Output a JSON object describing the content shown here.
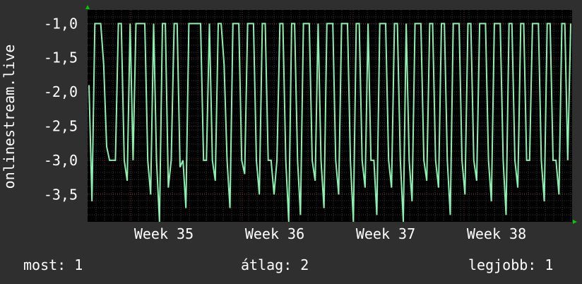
{
  "chart_data": {
    "type": "line",
    "ylabel": "onlinestream.live",
    "yticks": [
      -1.0,
      -1.5,
      -2.0,
      -2.5,
      -3.0,
      -3.5
    ],
    "ytick_labels": [
      "-1,0",
      "-1,5",
      "-2,0",
      "-2,5",
      "-3,0",
      "-3,5"
    ],
    "ylim": [
      -3.9,
      -0.8
    ],
    "xticks": [
      "Week 35",
      "Week 36",
      "Week 37",
      "Week 38"
    ],
    "grid": true,
    "colors": {
      "background": "#2f2f2f",
      "plot_area": "#000000",
      "grid": "#3a3a3a",
      "grid_major": "#6b2f2f",
      "line": "#8ef0b0",
      "arrow": "#00cc00"
    },
    "series": [
      {
        "values": [
          -1.9,
          -3.6,
          -1.0,
          -1.0,
          -1.0,
          -1.6,
          -2.8,
          -3.0,
          -3.0,
          -3.0,
          -1.0,
          -1.0,
          -3.0,
          -3.3,
          -1.0,
          -3.0,
          -1.0,
          -1.0,
          -1.0,
          -1.0,
          -3.0,
          -3.5,
          -1.0,
          -3.0,
          -3.9,
          -1.0,
          -1.0,
          -3.4,
          -3.0,
          -1.0,
          -1.0,
          -3.1,
          -3.0,
          -3.7,
          -1.0,
          -1.0,
          -1.0,
          -1.0,
          -1.0,
          -3.0,
          -3.0,
          -1.0,
          -3.0,
          -3.3,
          -1.0,
          -1.0,
          -1.6,
          -3.0,
          -3.7,
          -1.0,
          -1.0,
          -1.0,
          -3.0,
          -3.2,
          -1.0,
          -1.0,
          -1.0,
          -3.0,
          -3.5,
          -1.0,
          -1.0,
          -3.0,
          -3.0,
          -3.5,
          -3.0,
          -1.0,
          -1.0,
          -3.0,
          -3.9,
          -1.0,
          -1.0,
          -3.0,
          -3.8,
          -1.0,
          -1.0,
          -1.0,
          -3.0,
          -3.3,
          -1.0,
          -3.0,
          -3.7,
          -1.0,
          -1.0,
          -1.0,
          -3.0,
          -3.5,
          -1.0,
          -1.0,
          -1.0,
          -3.0,
          -3.9,
          -1.0,
          -1.0,
          -3.0,
          -3.4,
          -1.0,
          -3.0,
          -3.0,
          -3.8,
          -1.0,
          -1.0,
          -1.0,
          -3.0,
          -3.4,
          -1.0,
          -1.0,
          -3.0,
          -3.9,
          -1.0,
          -3.0,
          -3.6,
          -1.0,
          -1.0,
          -1.0,
          -3.0,
          -3.3,
          -1.0,
          -1.0,
          -3.0,
          -3.4,
          -1.0,
          -1.0,
          -3.0,
          -3.8,
          -1.0,
          -1.0,
          -1.0,
          -3.0,
          -3.5,
          -1.0,
          -1.0,
          -3.0,
          -3.3,
          -1.0,
          -1.0,
          -1.0,
          -3.0,
          -3.6,
          -1.0,
          -1.0,
          -1.0,
          -3.0,
          -3.8,
          -1.0,
          -1.0,
          -3.0,
          -3.4,
          -1.0,
          -1.0,
          -3.0,
          -3.0,
          -1.0,
          -1.0,
          -1.0,
          -3.0,
          -3.6,
          -1.0,
          -1.0,
          -3.0,
          -3.0,
          -3.5,
          -1.0,
          -1.0,
          -3.0,
          -1.0
        ]
      }
    ]
  },
  "stats": {
    "now": "most: 1",
    "avg": "átlag: 2",
    "best": "legjobb: 1"
  }
}
